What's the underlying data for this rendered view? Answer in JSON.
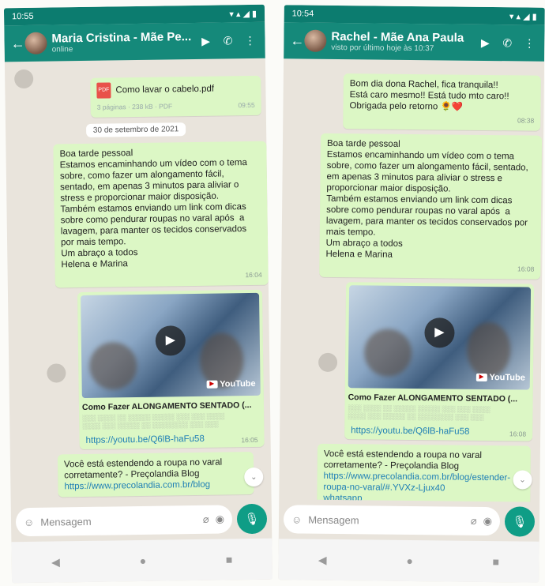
{
  "phones": [
    {
      "status_time": "10:55",
      "contact_name": "Maria Cristina - Mãe Pe...",
      "contact_status": "online",
      "doc_name": "Como lavar o cabelo.pdf",
      "doc_pages": "3 páginas · 238 kB · PDF",
      "doc_time": "09:55",
      "date_label": "30 de setembro de 2021",
      "message": "Boa tarde pessoal\nEstamos encaminhando um vídeo com o tema sobre, como fazer um alongamento fácil, sentado, em apenas 3 minutos para aliviar o stress e proporcionar maior disposição.\nTambém estamos enviando um link com dicas sobre como pendurar roupas no varal após  a lavagem, para manter os tecidos conservados por mais tempo.\nUm abraço a todos\nHelena e Marina",
      "message_time": "16:04",
      "video_title": "Como Fazer ALONGAMENTO SENTADO (...",
      "youtube_label": "YouTube",
      "video_link": "https://youtu.be/Q6lB-haFu58",
      "video_time": "16:05",
      "last_message": "Você está estendendo a roupa no varal corretamente? - Preçolandia Blog",
      "last_link": "https://www.precolandia.com.br/blog",
      "input_placeholder": "Mensagem"
    },
    {
      "status_time": "10:54",
      "contact_name": "Rachel - Mãe Ana Paula",
      "contact_status": "visto por último hoje às 10:37",
      "reply_message": "Bom dia dona Rachel, fica tranquila!!\nEstá caro mesmo!! Está tudo mto caro!!\nObrigada pelo retorno 🌻❤️",
      "reply_time": "08:38",
      "message": "Boa tarde pessoal\nEstamos encaminhando um vídeo com o tema sobre, como fazer um alongamento fácil, sentado, em apenas 3 minutos para aliviar o stress e proporcionar maior disposição.\nTambém estamos enviando um link com dicas sobre como pendurar roupas no varal após  a lavagem, para manter os tecidos conservados por mais tempo.\nUm abraço a todos\nHelena e Marina",
      "message_time": "16:08",
      "video_title": "Como Fazer ALONGAMENTO SENTADO (...",
      "youtube_label": "YouTube",
      "video_link": "https://youtu.be/Q6lB-haFu58",
      "video_time": "16:08",
      "last_message": "Você está estendendo a roupa no varal corretamente? - Preçolandia Blog",
      "last_link": "https://www.precolandia.com.br/blog/estender-roupa-no-varal/#.YVXz-Ljux40",
      "last_link_tail": "whatsapp",
      "input_placeholder": "Mensagem"
    }
  ],
  "icons": {
    "back": "←",
    "video_call": "▶",
    "call": "✆",
    "menu": "⋮",
    "play": "▶",
    "attach": "⌀",
    "camera": "◉",
    "mic": "🎙",
    "emoji": "☺",
    "nav_back": "◀",
    "nav_home": "●",
    "nav_recent": "■",
    "scroll_down": "⌄"
  },
  "colors": {
    "header": "#15897a",
    "outgoing_bubble": "#dcf7c5",
    "link": "#1e7fb5",
    "mic_button": "#0f9d86"
  }
}
